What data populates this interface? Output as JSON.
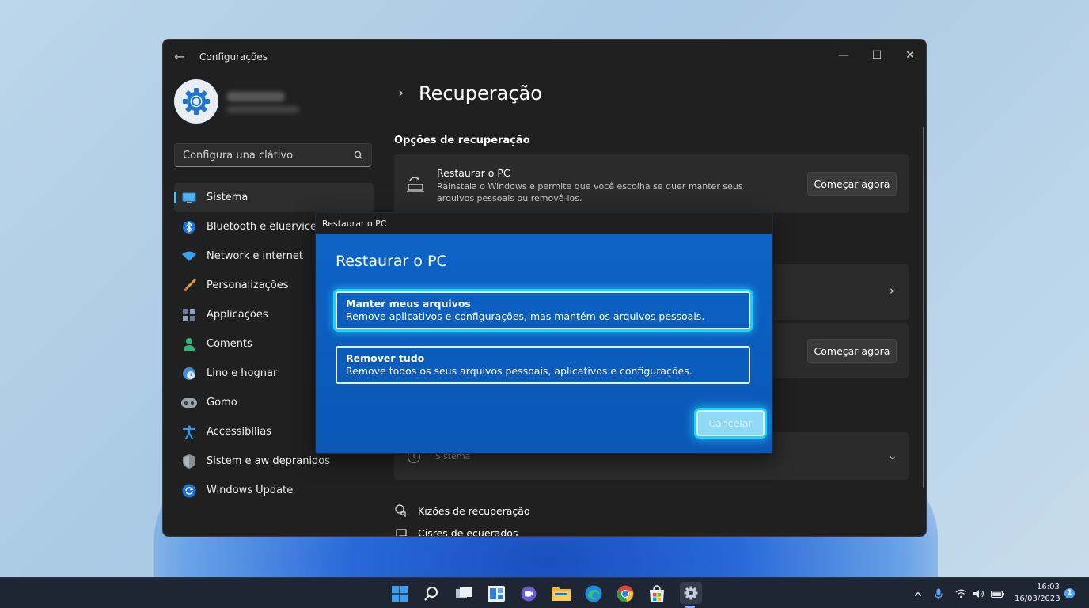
{
  "window": {
    "app_title": "Configurações",
    "controls": {
      "minimize": "—",
      "maximize": "☐",
      "close": "✕"
    }
  },
  "search": {
    "placeholder": "Configura una clátivo"
  },
  "sidebar": {
    "items": [
      {
        "label": "Sistema",
        "icon": "monitor-icon",
        "active": true
      },
      {
        "label": "Bluetooth e eluervices",
        "icon": "bluetooth-icon"
      },
      {
        "label": "Network e internet",
        "icon": "wifi-icon"
      },
      {
        "label": "Personalizações",
        "icon": "brush-icon"
      },
      {
        "label": "Applicações",
        "icon": "apps-icon"
      },
      {
        "label": "Coments",
        "icon": "person-icon"
      },
      {
        "label": "Lino e hognar",
        "icon": "globe-clock-icon"
      },
      {
        "label": "Gomo",
        "icon": "gamepad-icon"
      },
      {
        "label": "Accessibilias",
        "icon": "accessibility-icon"
      },
      {
        "label": "Sistem e aw depranidos",
        "icon": "shield-icon"
      },
      {
        "label": "Windows Update",
        "icon": "update-icon"
      }
    ]
  },
  "main": {
    "title": "Recuperação",
    "section_title": "Opções de recuperação",
    "reset_card": {
      "title": "Restaurar o PC",
      "description": "Rainstala o Windows e permite que você escolha se quer manter seus arquivos pessoais ou removê-los.",
      "button": "Começar agora"
    },
    "card3_button": "Começar agora",
    "card4_text": "Sistema",
    "links": [
      "Kızões de recuperação",
      "Cisres de ecuerados"
    ]
  },
  "dialog": {
    "bar_title": "Restaurar o PC",
    "heading": "Restaurar o PC",
    "options": [
      {
        "title": "Manter meus arquivos",
        "description": "Remove aplicativos e configurações, mas mantém os arquivos pessoais."
      },
      {
        "title": "Remover tudo",
        "description": "Remove todos os seus arquivos pessoais, aplicativos e configurações."
      }
    ],
    "cancel": "Cancelar"
  },
  "taskbar": {
    "time": "16:03",
    "date": "16/03/2023",
    "notification_count": "1"
  },
  "colors": {
    "accent": "#4cc2ff",
    "dialog_blue": "#0a5bbf",
    "focus_glow": "#1ed1ff",
    "window_bg": "#202020",
    "card_bg": "#2b2b2b"
  }
}
